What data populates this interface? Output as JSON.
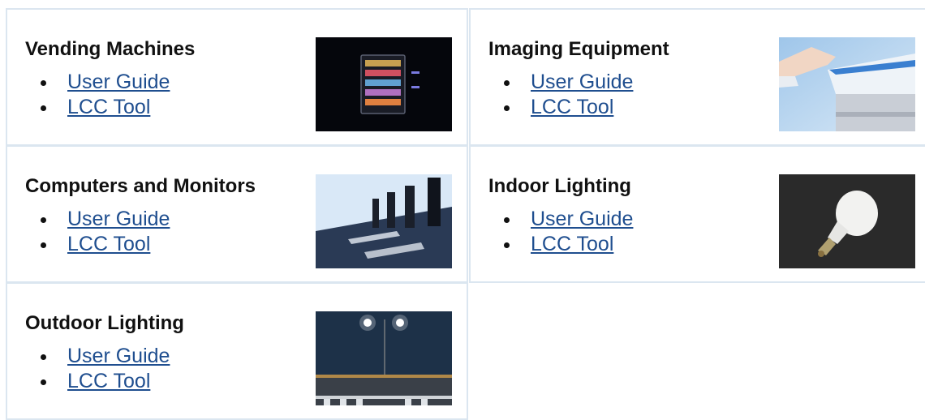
{
  "products": [
    {
      "title": "Vending Machines",
      "links": [
        "User Guide",
        "LCC Tool"
      ],
      "image": "vending-machine-photo"
    },
    {
      "title": "Imaging Equipment",
      "links": [
        "User Guide",
        "LCC Tool"
      ],
      "image": "copier-photo"
    },
    {
      "title": "Computers and Monitors",
      "links": [
        "User Guide",
        "LCC Tool"
      ],
      "image": "computers-photo"
    },
    {
      "title": "Indoor Lighting",
      "links": [
        "User Guide",
        "LCC Tool"
      ],
      "image": "light-bulb-photo"
    },
    {
      "title": "Outdoor Lighting",
      "links": [
        "User Guide",
        "LCC Tool"
      ],
      "image": "street-lights-photo"
    }
  ],
  "colors": {
    "border": "#dbe6f0",
    "link": "#1f4e8f",
    "heading": "#111111"
  }
}
